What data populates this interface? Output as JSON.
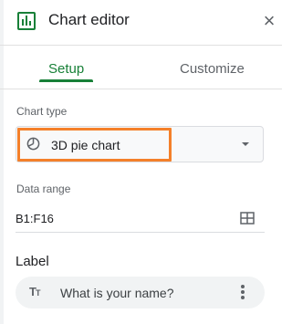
{
  "header": {
    "title": "Chart editor",
    "close_glyph": "×",
    "logo_icon": "chart-editor-icon",
    "accent_color": "#188038"
  },
  "tabs": [
    {
      "label": "Setup",
      "active": true
    },
    {
      "label": "Customize",
      "active": false
    }
  ],
  "chart_type": {
    "label": "Chart type",
    "value": "3D pie chart",
    "icon": "pie-chart-icon",
    "highlight_color": "#f4802a"
  },
  "data_range": {
    "label": "Data range",
    "value": "B1:F16",
    "icon": "grid-select-icon"
  },
  "label_section": {
    "title": "Label",
    "chip_icon": "text-type-icon",
    "chip_icon_glyph": "Tт",
    "chip_text": "What is your name?",
    "menu_icon": "more-vert-icon"
  }
}
